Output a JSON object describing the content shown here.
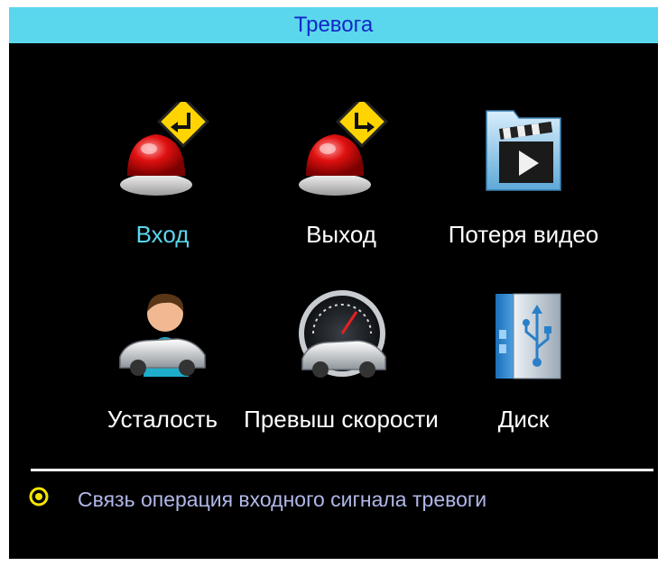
{
  "window": {
    "title": "Тревога"
  },
  "menu": {
    "items": [
      {
        "label": "Вход",
        "icon": "alarm-input-icon",
        "selected": true
      },
      {
        "label": "Выход",
        "icon": "alarm-output-icon",
        "selected": false
      },
      {
        "label": "Потеря видео",
        "icon": "video-loss-icon",
        "selected": false
      },
      {
        "label": "Усталость",
        "icon": "fatigue-driver-icon",
        "selected": false
      },
      {
        "label": "Превыш скорости",
        "icon": "speedometer-car-icon",
        "selected": false
      },
      {
        "label": "Диск",
        "icon": "disk-usb-icon",
        "selected": false
      }
    ]
  },
  "hint": {
    "icon": "info-ring-icon",
    "text": "Связь операция входного сигнала тревоги"
  },
  "colors": {
    "title_bar": "#5ad7ec",
    "title_text": "#1028c8",
    "background": "#000000",
    "selected_label": "#5ad7ec",
    "label": "#ffffff",
    "hint_text": "#b0b8e8",
    "hint_icon": "#f2e600"
  }
}
